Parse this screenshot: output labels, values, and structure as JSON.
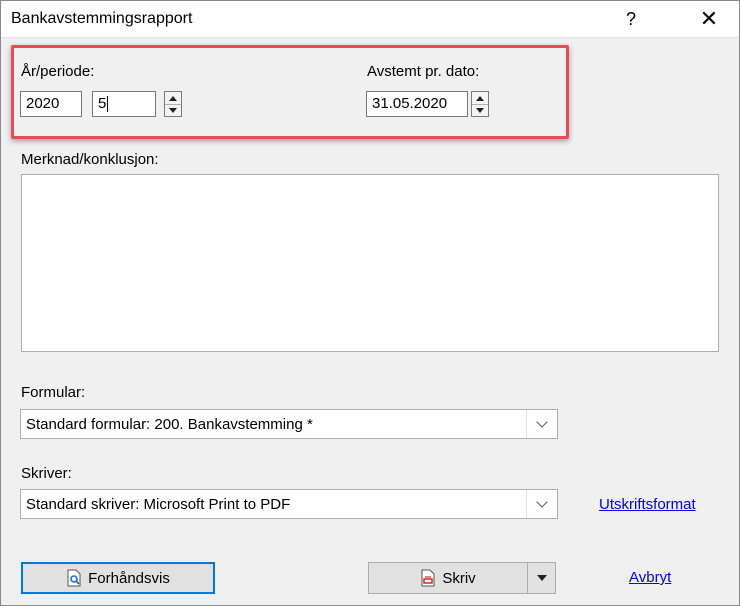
{
  "window": {
    "title": "Bankavstemmingsrapport",
    "help_label": "?",
    "close_label": "✕"
  },
  "period": {
    "label": "År/periode:",
    "year": "2020",
    "period": "5"
  },
  "date": {
    "label": "Avstemt pr. dato:",
    "value": "31.05.2020"
  },
  "remark": {
    "label": "Merknad/konklusjon:",
    "value": ""
  },
  "form": {
    "label": "Formular:",
    "value": "Standard formular: 200. Bankavstemming *"
  },
  "printer": {
    "label": "Skriver:",
    "value": "Standard skriver: Microsoft Print to PDF",
    "link": "Utskriftsformat"
  },
  "buttons": {
    "preview": "Forhåndsvis",
    "print": "Skriv",
    "cancel": "Avbryt"
  },
  "colors": {
    "highlight": "#e94b55",
    "link": "#0000ee",
    "default_border": "#0078d7"
  }
}
